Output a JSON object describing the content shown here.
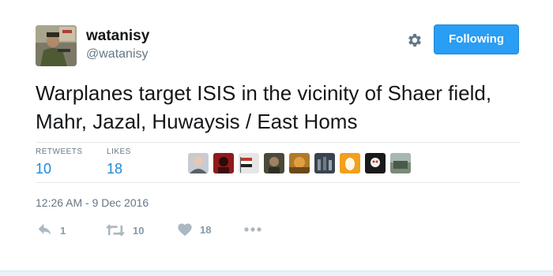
{
  "user": {
    "display_name": "watanisy",
    "handle": "@watanisy",
    "avatar_icon": "profile-avatar"
  },
  "follow_button": {
    "label": "Following",
    "color": "#2a9df4"
  },
  "settings_icon": "gear-icon",
  "tweet": {
    "text": "Warplanes target ISIS in the vicinity of Shaer field, Mahr, Jazal, Huwaysis / East Homs",
    "timestamp": "12:26 AM - 9 Dec 2016"
  },
  "stats": {
    "retweets_label": "RETWEETS",
    "retweets_value": "10",
    "likes_label": "LIKES",
    "likes_value": "18"
  },
  "likers": [
    {
      "icon": "liker-avatar-1",
      "color": "#8a8f96"
    },
    {
      "icon": "liker-avatar-2",
      "color": "#8e1b1b"
    },
    {
      "icon": "liker-avatar-3",
      "color": "#b8b8b8"
    },
    {
      "icon": "liker-avatar-4",
      "color": "#4a4a3a"
    },
    {
      "icon": "liker-avatar-5",
      "color": "#b07a2a"
    },
    {
      "icon": "liker-avatar-6",
      "color": "#3a4450"
    },
    {
      "icon": "liker-avatar-7",
      "color": "#f2a01e"
    },
    {
      "icon": "liker-avatar-8",
      "color": "#1a1a1a"
    },
    {
      "icon": "liker-avatar-9",
      "color": "#7a8a7a"
    }
  ],
  "actions": {
    "reply_count": "1",
    "retweet_count": "10",
    "like_count": "18",
    "action_icon_color": "#aab8c2"
  }
}
